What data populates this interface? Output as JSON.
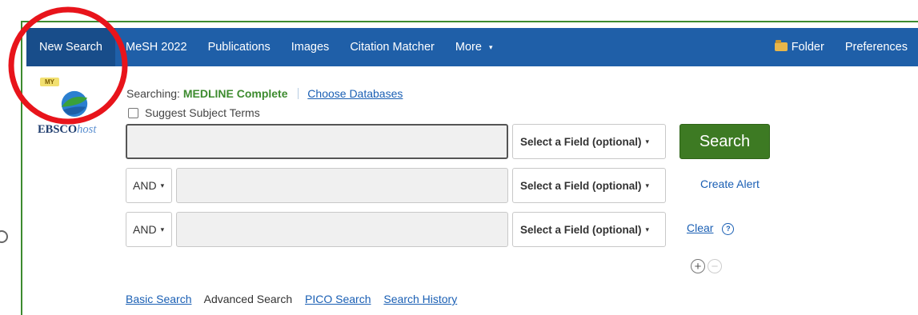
{
  "nav": {
    "items": [
      {
        "label": "New Search",
        "active": true
      },
      {
        "label": "MeSH 2022"
      },
      {
        "label": "Publications"
      },
      {
        "label": "Images"
      },
      {
        "label": "Citation Matcher"
      }
    ],
    "more_label": "More",
    "folder_label": "Folder",
    "preferences_label": "Preferences"
  },
  "logo": {
    "badge": "MY",
    "brand_bold": "EBSCO",
    "brand_italic": "host"
  },
  "searching": {
    "prefix": "Searching:",
    "database": "MEDLINE Complete",
    "choose_link": "Choose Databases"
  },
  "suggest_label": "Suggest Subject Terms",
  "search_rows": [
    {
      "operator": "",
      "value": "",
      "field": "Select a Field (optional)"
    },
    {
      "operator": "AND",
      "value": "",
      "field": "Select a Field (optional)"
    },
    {
      "operator": "AND",
      "value": "",
      "field": "Select a Field (optional)"
    }
  ],
  "actions": {
    "search_label": "Search",
    "create_alert_label": "Create Alert",
    "clear_label": "Clear",
    "help_glyph": "?",
    "add_row_glyph": "+",
    "remove_row_glyph": "−"
  },
  "bottom_links": [
    {
      "label": "Basic Search"
    },
    {
      "label": "Advanced Search"
    },
    {
      "label": "PICO Search"
    },
    {
      "label": "Search History"
    }
  ],
  "colors": {
    "navbar": "#1f5fa8",
    "search_button": "#3d7a23",
    "database_name": "#3d8b2f",
    "link": "#1a5fb4",
    "annotation": "#e8141b"
  },
  "icons": {
    "folder": "folder-icon",
    "help": "help-icon",
    "add": "plus-circle-icon",
    "remove": "minus-circle-icon"
  }
}
